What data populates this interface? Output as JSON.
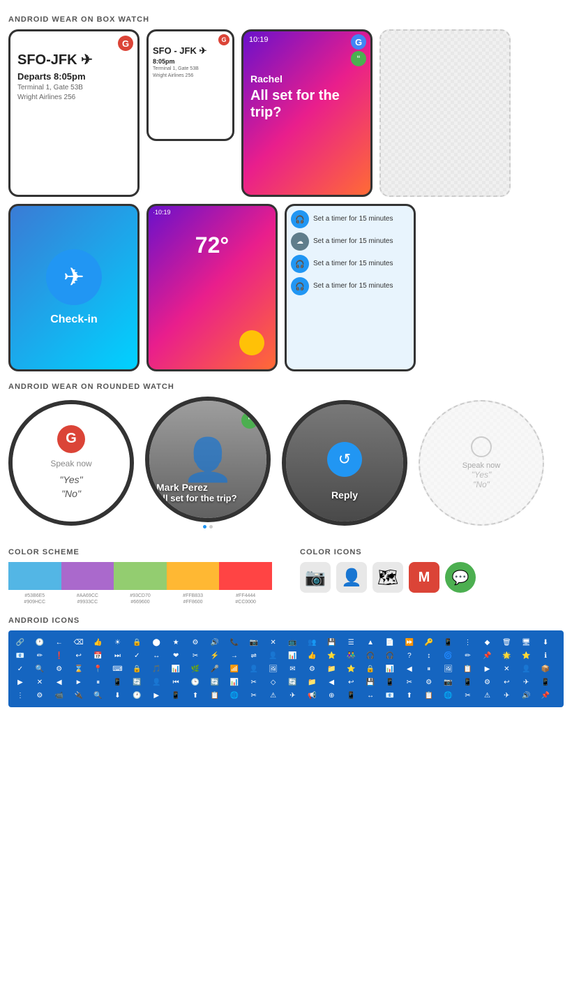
{
  "page": {
    "bg": "#ffffff"
  },
  "sections": {
    "box_watch": {
      "title": "ANDROID WEAR ON BOX WATCH",
      "devices": [
        {
          "type": "flight-large",
          "route": "SFO-JFK ✈",
          "departs": "Departs 8:05pm",
          "terminal": "Terminal 1, Gate 53B",
          "airline": "Wright Airlines 256"
        },
        {
          "type": "flight-medium",
          "route": "SFO - JFK ✈",
          "departs": "8:05pm",
          "terminal": "Terminal 1, Gate 53B",
          "airline": "Wright Airlines 256"
        },
        {
          "type": "message",
          "time": "10:19",
          "sender": "Rachel",
          "message": "All set for the trip?"
        },
        {
          "type": "ghost"
        },
        {
          "type": "checkin",
          "label": "Check-in"
        },
        {
          "type": "weather",
          "time": "·10:19",
          "temp": "72°"
        },
        {
          "type": "timer",
          "items": [
            {
              "icon": "headphone",
              "text": "Set a timer for 15\nminutes"
            },
            {
              "icon": "cloud",
              "text": "Set a timer for 15\nminutes"
            },
            {
              "icon": "headphone",
              "text": "Set a timer for 15\nminutes"
            },
            {
              "icon": "headphone",
              "text": "Set a timer for 15\nminutes"
            }
          ]
        }
      ]
    },
    "rounded_watch": {
      "title": "ANDROID WEAR ON ROUNDED WATCH",
      "devices": [
        {
          "type": "voice",
          "speak_label": "Speak now",
          "options": [
            "\"Yes\"",
            "\"No\""
          ]
        },
        {
          "type": "contact",
          "name": "Mark Perez",
          "message": "All set for the trip?"
        },
        {
          "type": "reply",
          "label": "Reply"
        },
        {
          "type": "ghost-voice",
          "speak_label": "Speak now",
          "options": [
            "\"Yes\"",
            "\"No\""
          ]
        }
      ]
    },
    "color_scheme": {
      "title": "COLOR SCHEME",
      "swatches": [
        {
          "color": "#53b6e5",
          "top_label": "#53B6E5",
          "bottom_label": "#909HCC"
        },
        {
          "color": "#aa69cc",
          "top_label": "#AA69CC",
          "bottom_label": "#9933CC"
        },
        {
          "color": "#93cd70",
          "top_label": "#93CD70",
          "bottom_label": "#669600"
        },
        {
          "color": "#ffb833",
          "top_label": "#FFB833",
          "bottom_label": "#FF8600"
        },
        {
          "color": "#ff4444",
          "top_label": "#FF4444",
          "bottom_label": "#CC0000"
        }
      ]
    },
    "color_icons": {
      "title": "COLOR ICONS",
      "icons": [
        {
          "type": "camera",
          "symbol": "📷"
        },
        {
          "type": "contact",
          "symbol": "👤"
        },
        {
          "type": "map",
          "symbol": "🗺"
        },
        {
          "type": "gmail",
          "symbol": "M",
          "bg": "#db4437"
        },
        {
          "type": "hangouts",
          "symbol": "💬",
          "bg": "#4caf50"
        }
      ]
    },
    "android_icons": {
      "title": "ANDROID ICONS",
      "icons": [
        "🔗",
        "🕐",
        "←",
        "⌫",
        "👍",
        "☀",
        "🔒",
        "🔵",
        "★",
        "⚙",
        "🔊",
        "📞",
        "📷",
        "✕",
        "📺",
        "👥",
        "💾",
        "☰",
        "▲",
        "📄",
        "⏩",
        "🔑",
        "📱",
        "⋮",
        "◆",
        "🗑",
        "🖥",
        "⬇",
        "📧",
        "✏",
        "❗",
        "↩",
        "📅",
        "⏭",
        "✓",
        "↔",
        "❤",
        "✂",
        "⚡",
        "→",
        "⇌",
        "👤",
        "📊",
        "👍",
        "⭐",
        "👫",
        "🎧",
        "🎧",
        "?",
        "↕",
        "🌀",
        "✏",
        "📌",
        "🌟",
        "⭐",
        "ℹ",
        "✓",
        "🔍",
        "⚙",
        "⌛",
        "📍",
        "⌨",
        "🔒",
        "🎵",
        "📊",
        "🌿",
        "🎤",
        "📶",
        "👤",
        "🖼",
        "✉",
        "⚙",
        "📁",
        "⭐",
        "🔒",
        "📊",
        "◀",
        "⏸",
        "🖼",
        "📋",
        "▶",
        "✕",
        "👤",
        "📦",
        "▶",
        "✕",
        "◀",
        "►",
        "⏸",
        "📱",
        "🔄",
        "👤",
        "⏮",
        "🕒",
        "🔄",
        "📊",
        "✂",
        "◇",
        "🔄",
        "📁",
        "◀",
        "↩",
        "💾",
        "📱",
        "✂",
        "⚙",
        "📷",
        "📱",
        "⚙",
        "↩",
        "✈",
        "📱",
        "⋮",
        "⚙",
        "📹",
        "USB",
        "🔍",
        "⬇",
        "🕐",
        "▶",
        "📱",
        "⬆",
        "📋",
        "🌐",
        "✂",
        "⚠",
        "✈",
        "📢"
      ]
    }
  }
}
